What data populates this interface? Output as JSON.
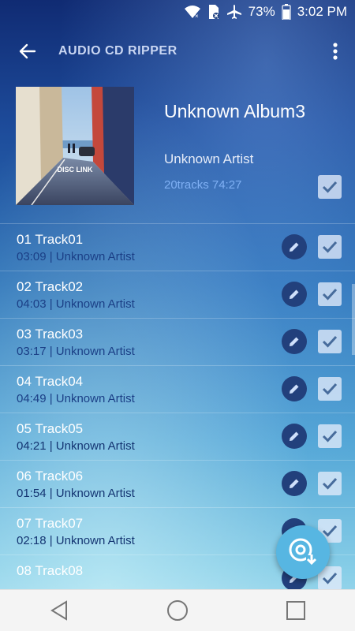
{
  "status": {
    "battery_pct": "73%",
    "time": "3:02 PM",
    "icons": [
      "wifi-icon",
      "sim-blocked-icon",
      "airplane-icon",
      "battery-icon"
    ]
  },
  "appbar": {
    "title": "AUDIO CD RIPPER",
    "back_icon": "back-arrow-icon",
    "menu_icon": "more-vert-icon"
  },
  "album": {
    "art_caption": "DISC LINK",
    "title": "Unknown Album3",
    "artist": "Unknown Artist",
    "meta": "20tracks 74:27",
    "selected": true
  },
  "tracks": [
    {
      "title": "01  Track01",
      "sub": "03:09 | Unknown Artist"
    },
    {
      "title": "02  Track02",
      "sub": "04:03 | Unknown Artist"
    },
    {
      "title": "03  Track03",
      "sub": "03:17 | Unknown Artist"
    },
    {
      "title": "04  Track04",
      "sub": "04:49 | Unknown Artist"
    },
    {
      "title": "05  Track05",
      "sub": "04:21 | Unknown Artist"
    },
    {
      "title": "06  Track06",
      "sub": "01:54 | Unknown Artist"
    },
    {
      "title": "07  Track07",
      "sub": "02:18 | Unknown Artist"
    },
    {
      "title": "08  Track08",
      "sub": ""
    }
  ],
  "fab": {
    "icon": "rip-disc-icon"
  },
  "navbar": {
    "icons": [
      "nav-back-icon",
      "nav-home-icon",
      "nav-recents-icon"
    ]
  },
  "colors": {
    "accent": "#7fb0f4",
    "edit_button": "#22407c",
    "fab": "#57b6e2"
  }
}
